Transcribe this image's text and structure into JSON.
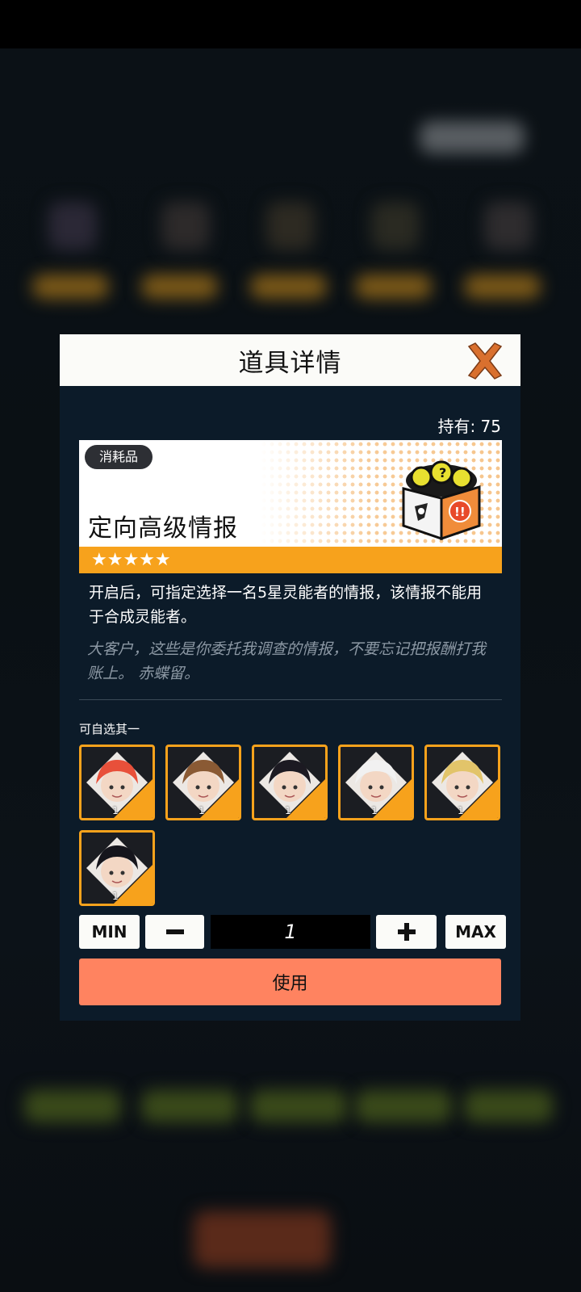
{
  "dialog": {
    "title": "道具详情",
    "held": "持有: 75",
    "item": {
      "tag": "消耗品",
      "name": "定向高级情报",
      "stars": "★★★★★",
      "description": "开启后，可指定选择一名5星灵能者的情报，该情报不能用于合成灵能者。",
      "flavor": "大客户，这些是你委托我调查的情报，不要忘记把报酬打我账上。 赤蝶留。",
      "icon": "box-icon"
    },
    "choose_label": "可自选其一",
    "characters": [
      {
        "qty": "1",
        "hair": "#e8503a",
        "icon": "character-portrait-icon"
      },
      {
        "qty": "1",
        "hair": "#8a5a34",
        "icon": "character-portrait-icon"
      },
      {
        "qty": "1",
        "hair": "#1c1a22",
        "icon": "character-portrait-icon"
      },
      {
        "qty": "1",
        "hair": "#f1f1f1",
        "icon": "character-portrait-icon"
      },
      {
        "qty": "1",
        "hair": "#e2c46a",
        "icon": "character-portrait-icon"
      },
      {
        "qty": "1",
        "hair": "#15151c",
        "icon": "character-portrait-icon"
      }
    ],
    "controls": {
      "min_label": "MIN",
      "minus_label": "−",
      "quantity": "1",
      "plus_label": "+",
      "max_label": "MAX"
    },
    "use_label": "使用"
  },
  "colors": {
    "accent_orange": "#f7a21c",
    "use_button": "#ff8360",
    "close_x": "#d9702e",
    "dialog_bg": "#0c1b29"
  }
}
